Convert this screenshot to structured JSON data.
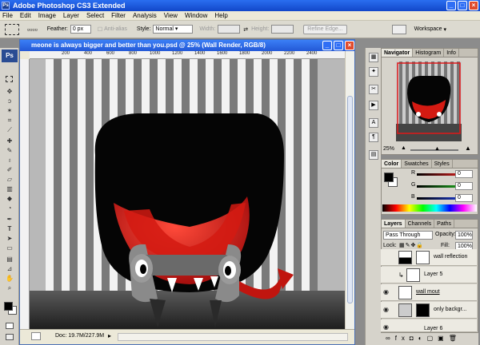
{
  "app": {
    "title": "Adobe Photoshop CS3 Extended"
  },
  "menu": [
    "File",
    "Edit",
    "Image",
    "Layer",
    "Select",
    "Filter",
    "Analysis",
    "View",
    "Window",
    "Help"
  ],
  "options": {
    "feather_label": "Feather:",
    "feather_value": "0 px",
    "antialias_label": "Anti-alias",
    "style_label": "Style:",
    "style_value": "Normal",
    "width_label": "Width:",
    "height_label": "Height:",
    "refine_label": "Refine Edge...",
    "workspace_label": "Workspace"
  },
  "document": {
    "title": "meone is always bigger and better than you.psd @ 25% (Wall Render, RGB/8)",
    "ruler_ticks": [
      "200",
      "400",
      "600",
      "800",
      "1000",
      "1200",
      "1400",
      "1600",
      "1800",
      "2000",
      "2200",
      "2400"
    ],
    "status": "Doc: 19.7M/227.9M"
  },
  "navigator": {
    "tabs": [
      "Navigator",
      "Histogram",
      "Info"
    ],
    "zoom": "25%"
  },
  "color": {
    "tabs": [
      "Color",
      "Swatches",
      "Styles"
    ],
    "channels": [
      {
        "label": "R",
        "value": "0",
        "color": "#e02020"
      },
      {
        "label": "G",
        "value": "0",
        "color": "#20b020"
      },
      {
        "label": "B",
        "value": "0",
        "color": "#2040e0"
      }
    ]
  },
  "layers": {
    "tabs": [
      "Layers",
      "Channels",
      "Paths"
    ],
    "blend_mode": "Pass Through",
    "opacity_label": "Opacity:",
    "opacity_value": "100%",
    "lock_label": "Lock:",
    "fill_label": "Fill:",
    "fill_value": "100%",
    "items": [
      {
        "name": "wall reflection"
      },
      {
        "name": "Layer 5"
      },
      {
        "name": "wall mout"
      },
      {
        "name": "only backgr..."
      },
      {
        "name": "Layer 6"
      }
    ]
  }
}
